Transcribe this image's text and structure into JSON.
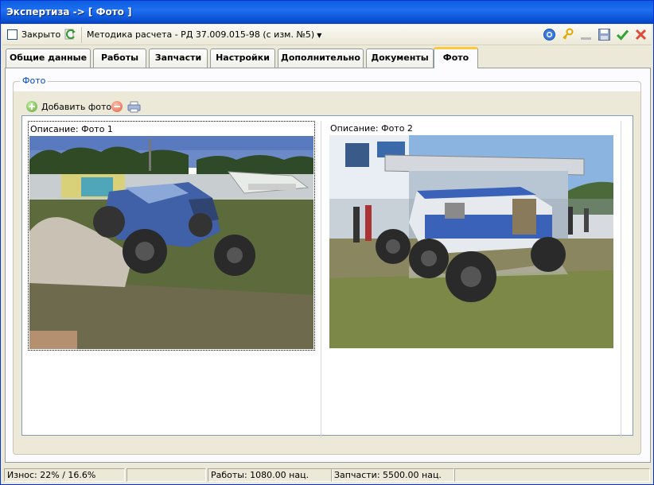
{
  "window": {
    "title": "Экспертиза -> [ Фото ]"
  },
  "toolbar": {
    "closed_label": "Закрыто",
    "closed_checked": false,
    "method_label": "Методика расчета - РД 37.009.015-98 (с изм. №5)",
    "icons": [
      "refresh-icon",
      "help-icon",
      "key-icon",
      "minimize-icon",
      "save-icon",
      "ok-check-icon",
      "close-x-icon"
    ]
  },
  "tabs": [
    {
      "label": "Общие данные"
    },
    {
      "label": "Работы"
    },
    {
      "label": "Запчасти"
    },
    {
      "label": "Настройки"
    },
    {
      "label": "Дополнительно"
    },
    {
      "label": "Документы"
    },
    {
      "label": "Фото",
      "active": true
    }
  ],
  "photo_group": {
    "title": "Фото",
    "add_label": "Добавить фото",
    "photos": [
      {
        "caption": "Описание:  Фото 1",
        "selected": true
      },
      {
        "caption": "Описание:  Фото 2",
        "selected": false
      }
    ]
  },
  "statusbar": {
    "wear": "Износ: 22% / 16.6%",
    "cell2": "",
    "cell3": "",
    "works": "Работы: 1080.00 нац.",
    "parts": "Запчасти: 5500.00 нац.",
    "cell6": ""
  },
  "colors": {
    "title_bar": "#0a5fe0",
    "accent_tab": "#ffc83c",
    "group_title": "#0046d5"
  }
}
